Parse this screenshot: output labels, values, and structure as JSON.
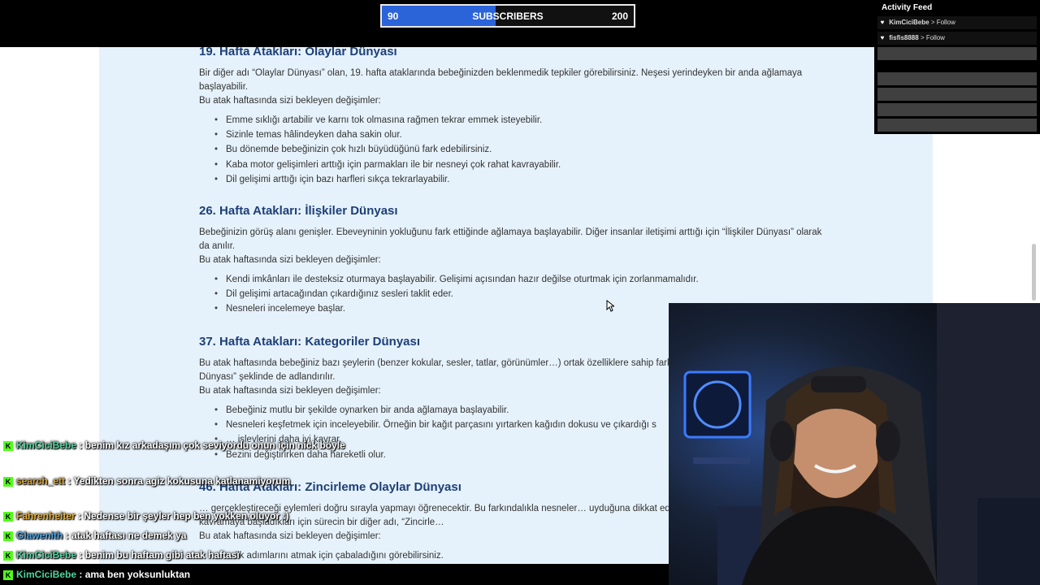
{
  "subscriber_goal": {
    "current": "90",
    "label": "SUBSCRIBERS",
    "goal": "200",
    "progress_fraction": 0.45,
    "fill_color": "#2b63d9"
  },
  "activity_feed": {
    "title": "Activity Feed",
    "items": [
      {
        "name": "KimCiciBebe",
        "action": "> Follow",
        "icon": "heart-icon"
      },
      {
        "name": "fisfis8888",
        "action": "> Follow",
        "icon": "heart-icon"
      }
    ]
  },
  "article": {
    "sections": [
      {
        "heading": "19. Hafta Atakları: Olaylar Dünyası",
        "intro": "Bir diğer adı “Olaylar Dünyası” olan, 19. hafta ataklarında bebeğinizden beklenmedik tepkiler görebilirsiniz. Neşesi yerindeyken bir anda ağlamaya başlayabilir.",
        "sub": "Bu atak haftasında sizi bekleyen değişimler:",
        "items": [
          "Emme sıklığı artabilir ve karnı tok olmasına rağmen tekrar emmek isteyebilir.",
          "Sizinle temas hâlindeyken daha sakin olur.",
          "Bu dönemde bebeğinizin çok hızlı büyüdüğünü fark edebilirsiniz.",
          "Kaba motor gelişimleri arttığı için parmakları ile bir nesneyi çok rahat kavrayabilir.",
          "Dil gelişimi arttığı için bazı harfleri sıkça tekrarlayabilir."
        ]
      },
      {
        "heading": "26. Hafta Atakları: İlişkiler Dünyası",
        "intro": "Bebeğinizin görüş alanı genişler. Ebeveyninin yokluğunu fark ettiğinde ağlamaya başlayabilir. Diğer insanlar iletişimi arttığı için “İlişkiler Dünyası” olarak da anılır.",
        "sub": "Bu atak haftasında sizi bekleyen değişimler:",
        "items": [
          "Kendi imkânları ile desteksiz oturmaya başlayabilir. Gelişimi açısından hazır değilse oturtmak için zorlanmamalıdır.",
          "Dil gelişimi artacağından çıkardığınız sesleri taklit eder.",
          "Nesneleri incelemeye başlar."
        ]
      },
      {
        "heading": "37. Hafta Atakları: Kategoriler Dünyası",
        "intro": "Bu atak haftasında bebeğiniz bazı şeylerin (benzer kokular, sesler, tatlar, görünümler…) ortak özelliklere sahip fark eder. Bu nedenle “Kategoriler Dünyası” şeklinde de adlandırılır.",
        "sub": "Bu atak haftasında sizi bekleyen değişimler:",
        "items": [
          "Bebeğiniz mutlu bir şekilde oynarken bir anda ağlamaya başlayabilir.",
          "Nesneleri keşfetmek için inceleyebilir. Örneğin bir kağıt parçasını yırtarken kağıdın dokusu ve çıkardığı s",
          "… işlevlerini daha iyi kavrar.",
          "Bezini değiştirirken daha hareketli olur."
        ]
      },
      {
        "heading": "46. Hafta Atakları: Zincirleme Olaylar Dünyası",
        "intro": "… gerçekleştireceği eylemleri doğru sırayla yapmayı öğrenecektir. Bu farkındalıkla nesneler… uyduğuna dikkat eder. Olaylar arasındaki bağlantıları kavramaya başladıkları için sürecin bir diğer adı, “Zincirle…",
        "sub": "Bu atak haftasında sizi bekleyen değişimler:",
        "items": [
          "…ilk adımlarını atmak için çabaladığını görebilirsiniz."
        ]
      }
    ]
  },
  "chat": {
    "messages": [
      {
        "name": "KimCiciBebe",
        "name_color": "#4fd6a0",
        "text": "benim kız arkadaşım çok seviyordu onun için nick böyle"
      },
      {
        "name": "search_ett",
        "name_color": "#d8a233",
        "text": "Yedikten sonra agiz kokusuna katlanamiyorum"
      },
      {
        "name": "Fahrenheiter",
        "name_color": "#e0b040",
        "text": "Nedense bir şeyler hep ben yokken oluyor :)"
      },
      {
        "name": "Glawenith",
        "name_color": "#4fa3e0",
        "text": "atak haftası ne demek ya"
      },
      {
        "name": "KimCiciBebe",
        "name_color": "#4fd6a0",
        "text": "benim bu haftam gibi atak haftası"
      },
      {
        "name": "KimCiciBebe",
        "name_color": "#4fd6a0",
        "text": "ama ben yoksunluktan"
      }
    ]
  }
}
